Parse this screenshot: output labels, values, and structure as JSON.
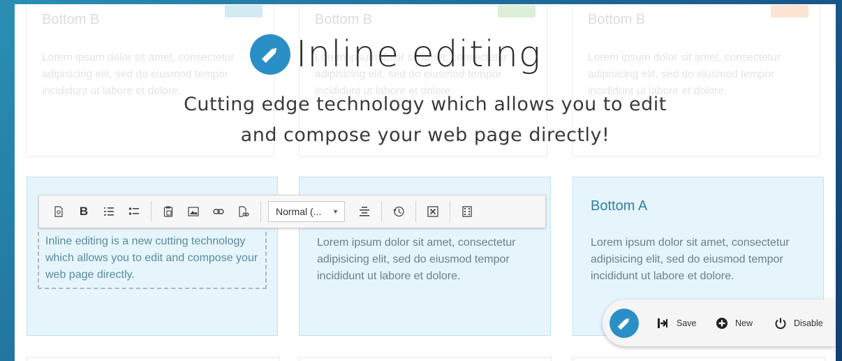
{
  "hero": {
    "title": "Inline editing",
    "subtitle": "Cutting edge technology which allows you to edit\nand compose your web page directly!"
  },
  "top_cards": [
    {
      "title": "Bottom B",
      "text": "Lorem ipsum dolor sit amet, consectetur adipisicing elit, sed do eiusmod tempor incididunt ut labore et dolore.",
      "badge_color": "#7fc6da"
    },
    {
      "title": "Bottom B",
      "text": "Lorem ipsum dolor sit amet, consectetur adipisicing elit, sed do eiusmod tempor incididunt ut labore et dolore.",
      "badge_color": "#9fd08f"
    },
    {
      "title": "Bottom B",
      "text": "Lorem ipsum dolor sit amet, consectetur adipisicing elit, sed do eiusmod tempor incididunt ut labore et dolore.",
      "badge_color": "#f4b27a"
    }
  ],
  "bottom_cards": [
    {
      "text": "Inline editing is a new cutting technology which allows you to edit and compose your web page directly."
    },
    {
      "text": "Lorem ipsum dolor sit amet, consectetur adipisicing elit, sed do eiusmod tempor incididunt ut labore et dolore."
    },
    {
      "title": "Bottom A",
      "text": "Lorem ipsum dolor sit amet, consectetur adipisicing elit, sed do eiusmod tempor incididunt ut labore et dolore."
    }
  ],
  "toolbar": {
    "format_value": "Normal (...",
    "bold_label": "B",
    "icons": [
      "source-icon",
      "bold-icon",
      "numbered-list-icon",
      "bulleted-list-icon",
      "paste-icon",
      "image-icon",
      "link-icon",
      "document-link-icon",
      "format-dropdown",
      "align-icon",
      "history-icon",
      "remove-format-icon",
      "media-icon"
    ]
  },
  "action_bar": {
    "save_label": "Save",
    "new_label": "New",
    "disable_label": "Disable"
  },
  "colors": {
    "accent": "#2b8fc7",
    "card_bg": "#e6f5fc",
    "card_title": "#2f7fa8"
  }
}
